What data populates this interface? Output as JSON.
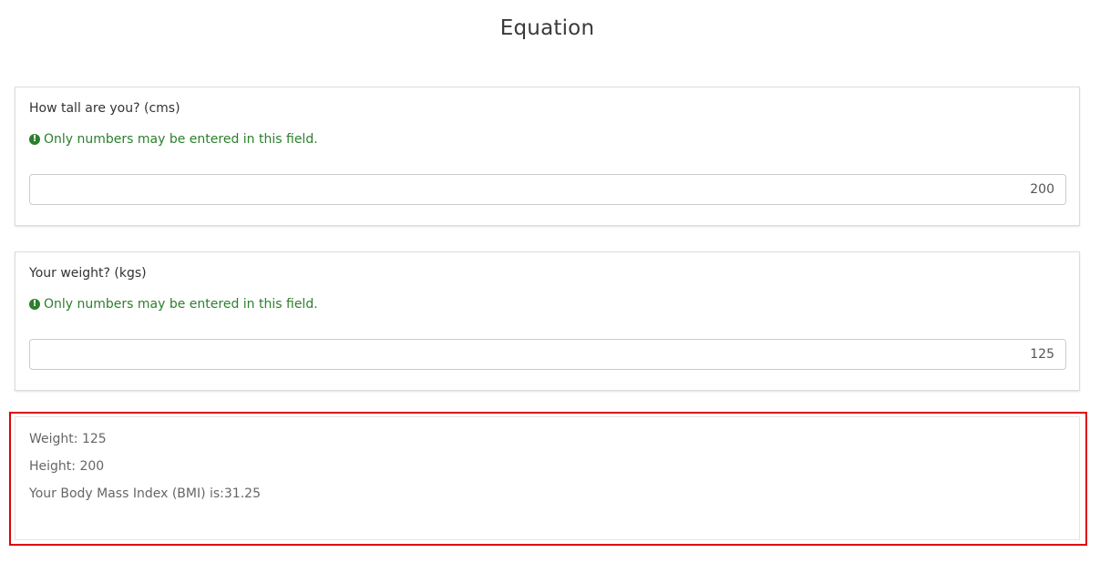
{
  "page": {
    "title": "Equation"
  },
  "questions": [
    {
      "label": "How tall are you? (cms)",
      "tip_icon": "exclamation-circle-icon",
      "tip": "Only numbers may be entered in this field.",
      "value": "200"
    },
    {
      "label": "Your weight? (kgs)",
      "tip_icon": "exclamation-circle-icon",
      "tip": "Only numbers may be entered in this field.",
      "value": "125"
    }
  ],
  "result": {
    "weight_line": "Weight: 125",
    "height_line": "Height: 200",
    "bmi_line": "Your Body Mass Index (BMI) is:31.25"
  },
  "colors": {
    "tip_green": "#2c7f2c",
    "highlight_red": "#e00000"
  }
}
